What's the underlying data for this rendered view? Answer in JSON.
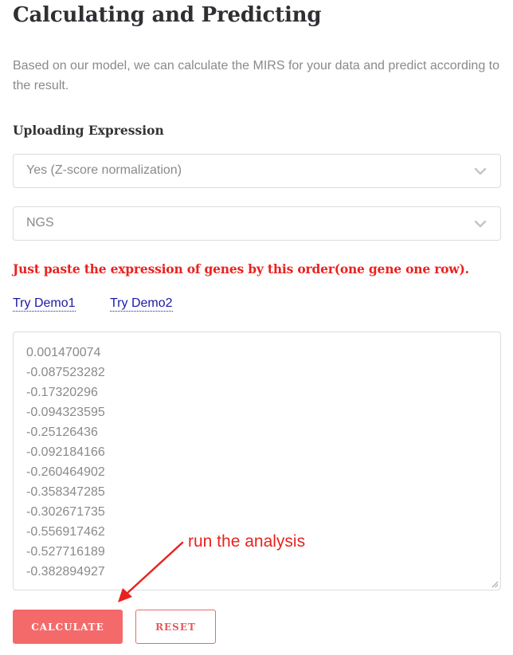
{
  "page": {
    "title": "Calculating and Predicting",
    "description": "Based on our model, we can calculate the MIRS for your data and predict according to the result."
  },
  "upload": {
    "section_label": "Uploading Expression",
    "normalization_select": {
      "selected": "Yes (Z-score normalization)",
      "icon": "chevron-down-icon"
    },
    "platform_select": {
      "selected": "NGS",
      "icon": "chevron-down-icon"
    },
    "notice": "Just paste the expression of genes by this order(one gene one row).",
    "demo_links": [
      "Try Demo1",
      "Try Demo2"
    ],
    "expression_values": [
      "0.001470074",
      "-0.087523282",
      "-0.17320296",
      "-0.094323595",
      "-0.25126436",
      "-0.092184166",
      "-0.260464902",
      "-0.358347285",
      "-0.302671735",
      "-0.556917462",
      "-0.527716189",
      "-0.382894927"
    ]
  },
  "annotation": {
    "text": "run the analysis",
    "color": "#e8231f"
  },
  "buttons": {
    "calculate": "CALCULATE",
    "reset": "RESET"
  },
  "colors": {
    "accent": "#f46a6a",
    "notice": "#e8231f",
    "link": "#1a1aa6"
  }
}
